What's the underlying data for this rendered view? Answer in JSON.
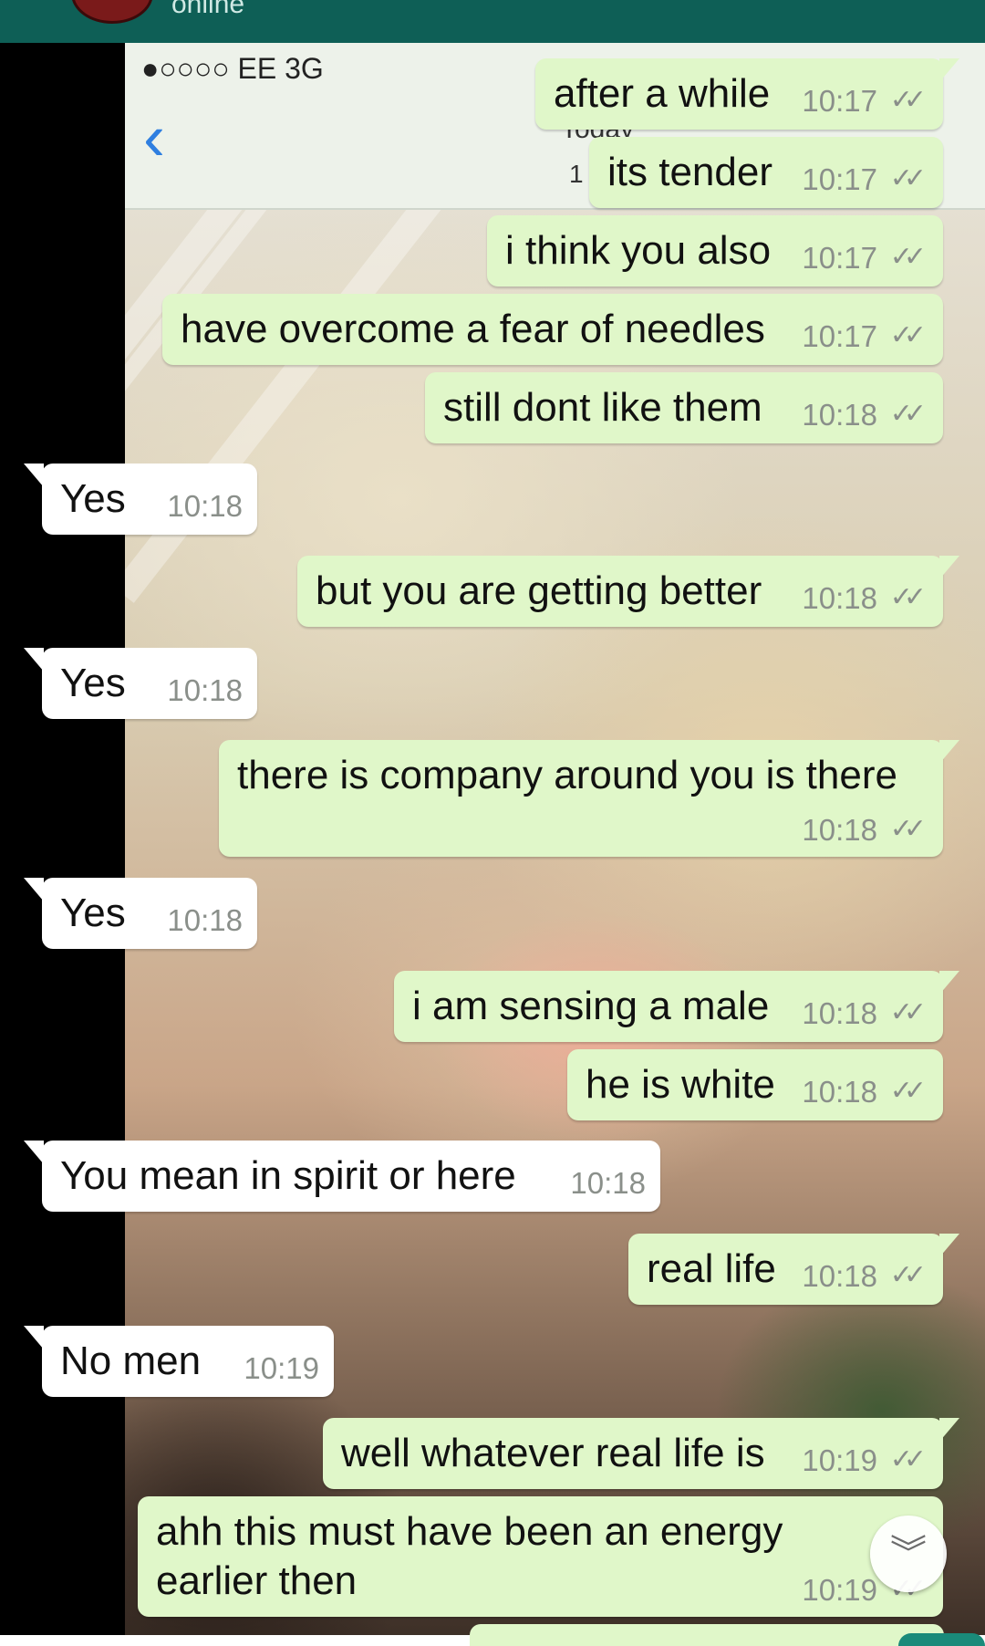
{
  "header": {
    "status": "online"
  },
  "inner_phone": {
    "carrier": "●○○○○ EE   3G",
    "back_icon": "chevron-left-icon",
    "partial_date": "Today",
    "partial_time": "1"
  },
  "messages": [
    {
      "dir": "out",
      "text": "after a while",
      "time": "10:17"
    },
    {
      "dir": "out",
      "text": "its tender",
      "time": "10:17"
    },
    {
      "dir": "out",
      "text": "i think you also",
      "time": "10:17"
    },
    {
      "dir": "out",
      "text": "have overcome a fear of needles",
      "time": "10:17"
    },
    {
      "dir": "out",
      "text": "still dont like them",
      "time": "10:18"
    },
    {
      "dir": "in",
      "text": "Yes",
      "time": "10:18"
    },
    {
      "dir": "out",
      "text": "but you are getting better",
      "time": "10:18"
    },
    {
      "dir": "in",
      "text": "Yes",
      "time": "10:18"
    },
    {
      "dir": "out",
      "text": "there is company around you is there",
      "time": "10:18"
    },
    {
      "dir": "in",
      "text": "Yes",
      "time": "10:18"
    },
    {
      "dir": "out",
      "text": "i am sensing a male",
      "time": "10:18"
    },
    {
      "dir": "out",
      "text": "he is white",
      "time": "10:18"
    },
    {
      "dir": "in",
      "text": "You mean in spirit or here",
      "time": "10:18"
    },
    {
      "dir": "out",
      "text": "real life",
      "time": "10:18"
    },
    {
      "dir": "in",
      "text": "No men",
      "time": "10:19"
    },
    {
      "dir": "out",
      "text": "well whatever real life is",
      "time": "10:19"
    },
    {
      "dir": "out",
      "text": "ahh this must have been an energy",
      "text2": "earlier then",
      "time": "10:19"
    }
  ],
  "read_ticks": "✓✓",
  "scroll_button_icon": "double-chevron-down-icon",
  "colors": {
    "header": "#0e5f56",
    "outgoing": "#e0f7c9",
    "incoming": "#ffffff",
    "timestamp": "#8a8f8a"
  }
}
